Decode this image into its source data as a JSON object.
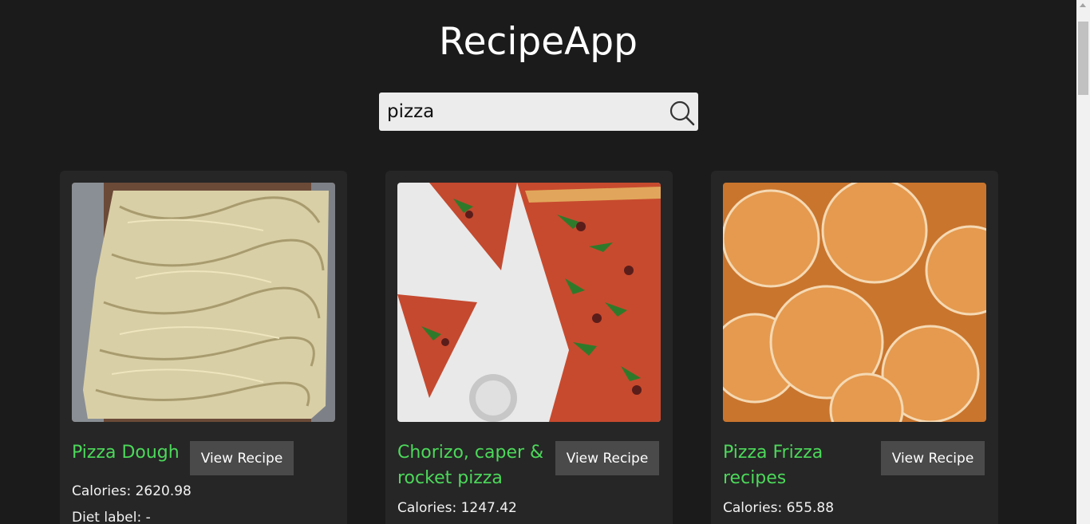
{
  "app": {
    "title": "RecipeApp"
  },
  "search": {
    "value": "pizza",
    "icon": "search-icon"
  },
  "recipes": [
    {
      "name": "Pizza Dough",
      "button": "View Recipe",
      "calories": "Calories: 2620.98",
      "diet": "Diet label: -"
    },
    {
      "name": "Chorizo, caper & rocket pizza",
      "button": "View Recipe",
      "calories": "Calories: 1247.42"
    },
    {
      "name": "Pizza Frizza recipes",
      "button": "View Recipe",
      "calories": "Calories: 655.88"
    }
  ],
  "colors": {
    "background": "#1b1b1b",
    "card": "#262626",
    "accent": "#4cd85a",
    "button": "#4a4a4a"
  }
}
